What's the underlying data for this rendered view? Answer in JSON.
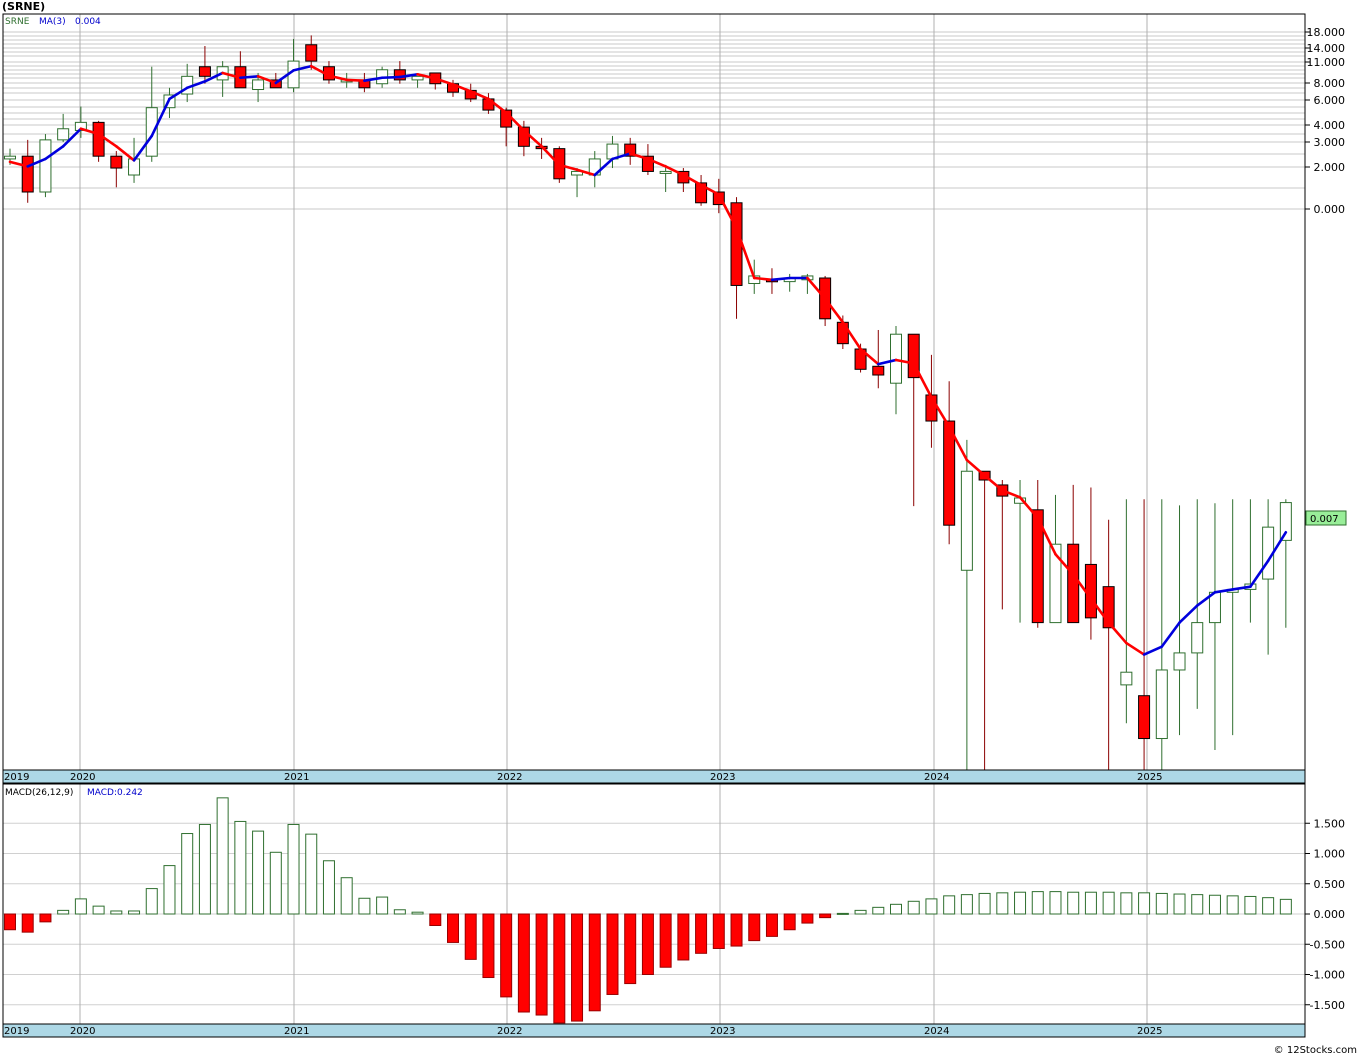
{
  "title": "(SRNE)",
  "copyright": "© 12Stocks.com",
  "colors": {
    "up_candle_stroke": "#2f6f2f",
    "down_candle_fill": "#ff0000",
    "ma_up": "#0000dd",
    "ma_down": "#ff0000",
    "axis_band": "#add8e6",
    "last_price_box": "#99ee99",
    "grid": "#b0b0b0"
  },
  "price_panel": {
    "symbol_label": "SRNE",
    "ma_label": "MA(3)",
    "ma_value": "0.004",
    "last_price": "0.007",
    "tick_labels": [
      "18.000",
      "14.000",
      "11.000",
      "8.000",
      "6.000",
      "4.000",
      "3.000",
      "2.000",
      "0.000"
    ],
    "year_labels": [
      "2019",
      "2020",
      "2021",
      "2022",
      "2023",
      "2024",
      "2025"
    ]
  },
  "macd_panel": {
    "label": "MACD(26,12,9)",
    "value_label": "MACD:0.242",
    "tick_labels": [
      "1.500",
      "1.000",
      "0.500",
      "0.000",
      "-0.500",
      "-1.000",
      "-1.500"
    ],
    "year_labels": [
      "2019",
      "2020",
      "2021",
      "2022",
      "2023",
      "2024",
      "2025"
    ]
  },
  "chart_data": [
    {
      "type": "candlestick",
      "title": "(SRNE)",
      "scale": "log",
      "period": "monthly",
      "x_range": [
        "2019-11",
        "2025-10"
      ],
      "series": [
        {
          "name": "SRNE",
          "ohlc": [
            [
              2.1,
              2.5,
              1.9,
              2.2
            ],
            [
              2.2,
              2.9,
              1.0,
              1.2
            ],
            [
              1.2,
              3.2,
              1.1,
              2.9
            ],
            [
              2.9,
              4.5,
              2.8,
              3.5
            ],
            [
              3.4,
              5.1,
              3.0,
              3.9
            ],
            [
              3.9,
              4.0,
              2.0,
              2.2
            ],
            [
              2.2,
              2.4,
              1.3,
              1.8
            ],
            [
              1.6,
              3.0,
              1.4,
              2.1
            ],
            [
              2.2,
              10.0,
              2.0,
              5.0
            ],
            [
              5.0,
              7.0,
              4.2,
              6.2
            ],
            [
              6.3,
              10.5,
              5.5,
              8.5
            ],
            [
              10.0,
              20.0,
              7.5,
              8.5
            ],
            [
              8.0,
              11.0,
              6.0,
              10.0
            ],
            [
              10.0,
              13.0,
              7.0,
              7.0
            ],
            [
              6.8,
              9.0,
              5.5,
              8.0
            ],
            [
              8.0,
              9.0,
              7.0,
              7.0
            ],
            [
              7.0,
              16.0,
              6.5,
              11.0
            ],
            [
              14.5,
              17.0,
              9.5,
              11.0
            ],
            [
              10.0,
              11.0,
              7.5,
              8.0
            ],
            [
              8.0,
              9.0,
              7.0,
              8.0
            ],
            [
              8.0,
              9.0,
              6.5,
              7.0
            ],
            [
              7.5,
              10.0,
              7.0,
              9.5
            ],
            [
              9.5,
              11.0,
              7.5,
              8.0
            ],
            [
              8.0,
              8.5,
              7.0,
              8.5
            ],
            [
              9.0,
              9.0,
              6.8,
              7.5
            ],
            [
              7.5,
              8.0,
              6.0,
              6.5
            ],
            [
              6.7,
              7.5,
              5.5,
              5.8
            ],
            [
              5.8,
              6.4,
              4.5,
              4.8
            ],
            [
              4.8,
              5.0,
              2.6,
              3.6
            ],
            [
              3.6,
              4.0,
              2.2,
              2.6
            ],
            [
              2.6,
              3.0,
              2.1,
              2.5
            ],
            [
              2.5,
              2.6,
              1.4,
              1.5
            ],
            [
              1.6,
              1.8,
              1.1,
              1.7
            ],
            [
              1.6,
              2.4,
              1.3,
              2.1
            ],
            [
              2.1,
              3.1,
              1.8,
              2.7
            ],
            [
              2.7,
              3.0,
              1.9,
              2.2
            ],
            [
              2.2,
              2.7,
              1.6,
              1.7
            ],
            [
              1.7,
              1.9,
              1.2,
              1.7
            ],
            [
              1.7,
              1.8,
              1.2,
              1.4
            ],
            [
              1.4,
              1.6,
              0.95,
              1.0
            ],
            [
              1.2,
              1.5,
              0.85,
              0.97
            ],
            [
              1.0,
              1.1,
              0.18,
              0.31
            ],
            [
              0.32,
              0.45,
              0.27,
              0.36
            ],
            [
              0.34,
              0.4,
              0.27,
              0.33
            ],
            [
              0.33,
              0.37,
              0.28,
              0.35
            ],
            [
              0.34,
              0.37,
              0.27,
              0.36
            ],
            [
              0.35,
              0.36,
              0.16,
              0.18
            ],
            [
              0.17,
              0.19,
              0.11,
              0.12
            ],
            [
              0.11,
              0.12,
              0.075,
              0.079
            ],
            [
              0.083,
              0.15,
              0.058,
              0.072
            ],
            [
              0.063,
              0.16,
              0.038,
              0.14
            ],
            [
              0.14,
              0.14,
              0.0085,
              0.069
            ],
            [
              0.052,
              0.1,
              0.022,
              0.034
            ],
            [
              0.034,
              0.065,
              0.0045,
              0.0062
            ],
            [
              0.0029,
              0.025,
              0.0001,
              0.015
            ],
            [
              0.015,
              0.015,
              0.0001,
              0.013
            ],
            [
              0.012,
              0.013,
              0.0015,
              0.01
            ],
            [
              0.0089,
              0.013,
              0.0012,
              0.0097
            ],
            [
              0.008,
              0.013,
              0.0011,
              0.0012
            ],
            [
              0.0012,
              0.0102,
              0.0013,
              0.0045
            ],
            [
              0.0045,
              0.012,
              0.0013,
              0.0012
            ],
            [
              0.0032,
              0.0115,
              0.0009,
              0.0013
            ],
            [
              0.0022,
              0.0068,
              0.0001,
              0.0011
            ],
            [
              0.00042,
              0.0095,
              0.00022,
              0.00052
            ],
            [
              0.00035,
              0.0095,
              7e-05,
              0.00017
            ],
            [
              0.00017,
              0.0095,
              7e-05,
              0.00054
            ],
            [
              0.00054,
              0.0086,
              0.00018,
              0.00072
            ],
            [
              0.00072,
              0.0095,
              0.00028,
              0.0012
            ],
            [
              0.0012,
              0.0089,
              0.00014,
              0.002
            ],
            [
              0.002,
              0.0095,
              0.00018,
              0.0021
            ],
            [
              0.0021,
              0.0095,
              0.0012,
              0.0023
            ],
            [
              0.0025,
              0.0095,
              0.0007,
              0.006
            ],
            [
              0.0048,
              0.0095,
              0.0011,
              0.009
            ]
          ]
        },
        {
          "name": "MA(3)",
          "values": [
            2.0,
            1.85,
            2.1,
            2.6,
            3.5,
            3.2,
            2.6,
            2.05,
            3.1,
            5.8,
            7.0,
            7.8,
            9.0,
            8.3,
            8.5,
            7.6,
            9.4,
            10.1,
            8.6,
            8.0,
            7.9,
            8.3,
            8.4,
            8.8,
            8.2,
            7.4,
            6.6,
            5.8,
            4.6,
            3.4,
            2.6,
            1.9,
            1.75,
            1.6,
            2.1,
            2.3,
            2.1,
            1.85,
            1.6,
            1.35,
            1.15,
            0.69,
            0.35,
            0.34,
            0.35,
            0.35,
            0.25,
            0.17,
            0.11,
            0.086,
            0.092,
            0.087,
            0.05,
            0.031,
            0.018,
            0.014,
            0.011,
            0.0098,
            0.007,
            0.0038,
            0.0027,
            0.0018,
            0.0012,
            0.00085,
            0.0007,
            0.0008,
            0.0012,
            0.0016,
            0.002,
            0.0021,
            0.0022,
            0.0034,
            0.0055
          ]
        }
      ]
    },
    {
      "type": "bar",
      "title": "MACD(26,12,9)",
      "ylim": [
        -1.8,
        2.0
      ],
      "series": [
        {
          "name": "MACD",
          "values": [
            -0.26,
            -0.3,
            -0.13,
            0.06,
            0.25,
            0.13,
            0.05,
            0.05,
            0.42,
            0.8,
            1.33,
            1.48,
            1.92,
            1.53,
            1.37,
            1.02,
            1.48,
            1.32,
            0.88,
            0.6,
            0.26,
            0.28,
            0.07,
            0.03,
            -0.19,
            -0.47,
            -0.75,
            -1.05,
            -1.37,
            -1.62,
            -1.67,
            -1.8,
            -1.77,
            -1.6,
            -1.33,
            -1.15,
            -1.0,
            -0.88,
            -0.76,
            -0.65,
            -0.57,
            -0.53,
            -0.44,
            -0.37,
            -0.26,
            -0.15,
            -0.06,
            0.01,
            0.06,
            0.11,
            0.16,
            0.21,
            0.25,
            0.3,
            0.32,
            0.34,
            0.35,
            0.36,
            0.37,
            0.37,
            0.36,
            0.36,
            0.36,
            0.35,
            0.35,
            0.34,
            0.33,
            0.32,
            0.31,
            0.3,
            0.29,
            0.27,
            0.242
          ]
        }
      ]
    }
  ]
}
